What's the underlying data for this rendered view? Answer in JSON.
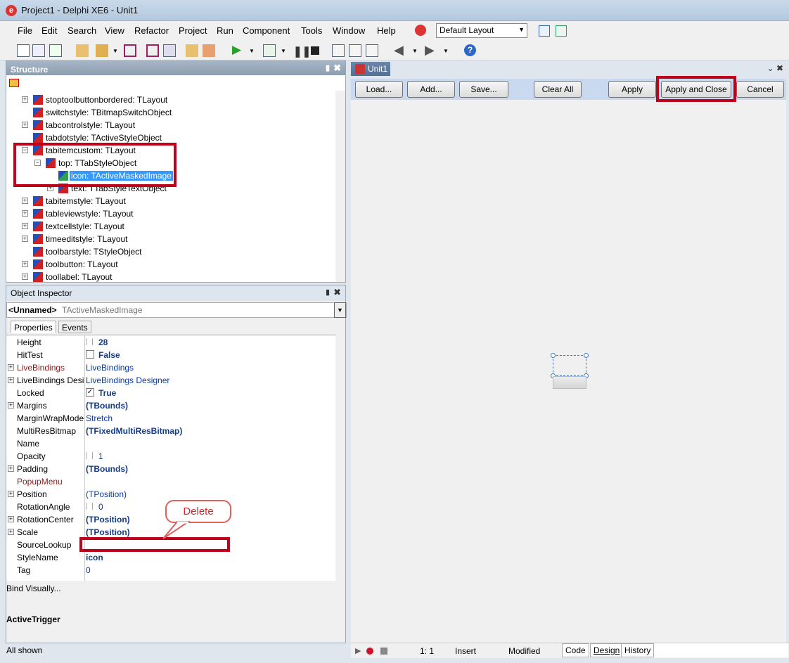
{
  "window": {
    "title": "Project1 - Delphi XE6 - Unit1"
  },
  "menu": [
    "File",
    "Edit",
    "Search",
    "View",
    "Refactor",
    "Project",
    "Run",
    "Component",
    "Tools",
    "Window",
    "Help"
  ],
  "layout_combo": {
    "value": "Default Layout"
  },
  "structure": {
    "title": "Structure",
    "rows": [
      {
        "label": "stoptoolbuttonbordered: TLayout"
      },
      {
        "label": "switchstyle: TBitmapSwitchObject"
      },
      {
        "label": "tabcontrolstyle: TLayout"
      },
      {
        "label": "tabdotstyle: TActiveStyleObject"
      },
      {
        "label": "tabitemcustom: TLayout"
      },
      {
        "label": "top: TTabStyleObject"
      },
      {
        "label": "icon: TActiveMaskedImage"
      },
      {
        "label": "text: TTabStyleTextObject"
      },
      {
        "label": "tabitemstyle: TLayout"
      },
      {
        "label": "tableviewstyle: TLayout"
      },
      {
        "label": "textcellstyle: TLayout"
      },
      {
        "label": "timeeditstyle: TLayout"
      },
      {
        "label": "toolbarstyle: TStyleObject"
      },
      {
        "label": "toolbutton: TLayout"
      },
      {
        "label": "toollabel: TLayout"
      }
    ]
  },
  "inspector": {
    "title": "Object Inspector",
    "object_name": "<Unnamed>",
    "object_type": "TActiveMaskedImage",
    "tabs": [
      "Properties",
      "Events"
    ],
    "properties": [
      {
        "name": "Height",
        "value": "28"
      },
      {
        "name": "HitTest",
        "value": "False"
      },
      {
        "name": "LiveBindings",
        "value": "LiveBindings"
      },
      {
        "name": "LiveBindings Designer",
        "value": "LiveBindings Designer"
      },
      {
        "name": "Locked",
        "value": "True"
      },
      {
        "name": "Margins",
        "value": "(TBounds)"
      },
      {
        "name": "MarginWrapMode",
        "value": "Stretch"
      },
      {
        "name": "MultiResBitmap",
        "value": "(TFixedMultiResBitmap)"
      },
      {
        "name": "Name",
        "value": ""
      },
      {
        "name": "Opacity",
        "value": "1"
      },
      {
        "name": "Padding",
        "value": "(TBounds)"
      },
      {
        "name": "PopupMenu",
        "value": ""
      },
      {
        "name": "Position",
        "value": "(TPosition)"
      },
      {
        "name": "RotationAngle",
        "value": "0"
      },
      {
        "name": "RotationCenter",
        "value": "(TPosition)"
      },
      {
        "name": "Scale",
        "value": "(TPosition)"
      },
      {
        "name": "SourceLookup",
        "value": ""
      },
      {
        "name": "StyleName",
        "value": "icon"
      },
      {
        "name": "Tag",
        "value": "0"
      }
    ],
    "bind_visually": "Bind Visually...",
    "active_trigger": "ActiveTrigger",
    "status": "All shown"
  },
  "designer": {
    "tab": "Unit1",
    "buttons": [
      "Load...",
      "Add...",
      "Save...",
      "Clear All",
      "Apply",
      "Apply and Close",
      "Cancel"
    ]
  },
  "status": {
    "pos": "1:   1",
    "mode": "Insert",
    "modified": "Modified",
    "tabs": [
      "Code",
      "Design",
      "History"
    ]
  },
  "callout": "Delete",
  "colors": {
    "highlight": "#c00018",
    "selection": "#3399ff"
  }
}
